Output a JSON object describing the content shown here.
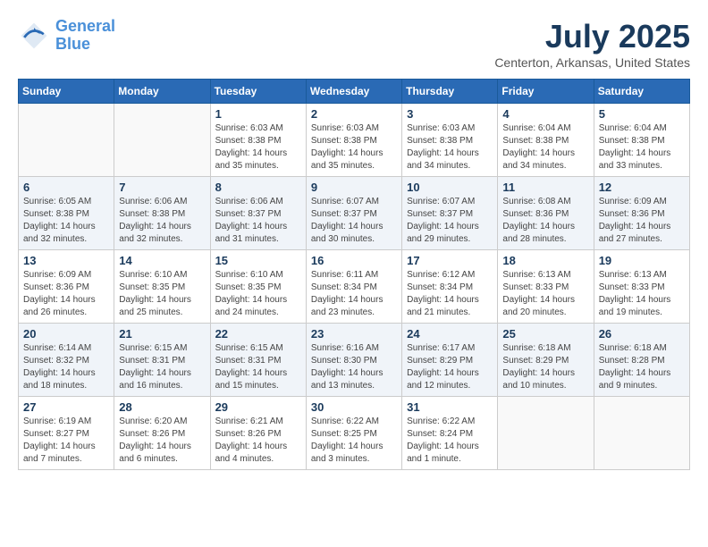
{
  "logo": {
    "line1": "General",
    "line2": "Blue"
  },
  "title": "July 2025",
  "location": "Centerton, Arkansas, United States",
  "weekdays": [
    "Sunday",
    "Monday",
    "Tuesday",
    "Wednesday",
    "Thursday",
    "Friday",
    "Saturday"
  ],
  "weeks": [
    [
      {
        "day": "",
        "sunrise": "",
        "sunset": "",
        "daylight": ""
      },
      {
        "day": "",
        "sunrise": "",
        "sunset": "",
        "daylight": ""
      },
      {
        "day": "1",
        "sunrise": "Sunrise: 6:03 AM",
        "sunset": "Sunset: 8:38 PM",
        "daylight": "Daylight: 14 hours and 35 minutes."
      },
      {
        "day": "2",
        "sunrise": "Sunrise: 6:03 AM",
        "sunset": "Sunset: 8:38 PM",
        "daylight": "Daylight: 14 hours and 35 minutes."
      },
      {
        "day": "3",
        "sunrise": "Sunrise: 6:03 AM",
        "sunset": "Sunset: 8:38 PM",
        "daylight": "Daylight: 14 hours and 34 minutes."
      },
      {
        "day": "4",
        "sunrise": "Sunrise: 6:04 AM",
        "sunset": "Sunset: 8:38 PM",
        "daylight": "Daylight: 14 hours and 34 minutes."
      },
      {
        "day": "5",
        "sunrise": "Sunrise: 6:04 AM",
        "sunset": "Sunset: 8:38 PM",
        "daylight": "Daylight: 14 hours and 33 minutes."
      }
    ],
    [
      {
        "day": "6",
        "sunrise": "Sunrise: 6:05 AM",
        "sunset": "Sunset: 8:38 PM",
        "daylight": "Daylight: 14 hours and 32 minutes."
      },
      {
        "day": "7",
        "sunrise": "Sunrise: 6:06 AM",
        "sunset": "Sunset: 8:38 PM",
        "daylight": "Daylight: 14 hours and 32 minutes."
      },
      {
        "day": "8",
        "sunrise": "Sunrise: 6:06 AM",
        "sunset": "Sunset: 8:37 PM",
        "daylight": "Daylight: 14 hours and 31 minutes."
      },
      {
        "day": "9",
        "sunrise": "Sunrise: 6:07 AM",
        "sunset": "Sunset: 8:37 PM",
        "daylight": "Daylight: 14 hours and 30 minutes."
      },
      {
        "day": "10",
        "sunrise": "Sunrise: 6:07 AM",
        "sunset": "Sunset: 8:37 PM",
        "daylight": "Daylight: 14 hours and 29 minutes."
      },
      {
        "day": "11",
        "sunrise": "Sunrise: 6:08 AM",
        "sunset": "Sunset: 8:36 PM",
        "daylight": "Daylight: 14 hours and 28 minutes."
      },
      {
        "day": "12",
        "sunrise": "Sunrise: 6:09 AM",
        "sunset": "Sunset: 8:36 PM",
        "daylight": "Daylight: 14 hours and 27 minutes."
      }
    ],
    [
      {
        "day": "13",
        "sunrise": "Sunrise: 6:09 AM",
        "sunset": "Sunset: 8:36 PM",
        "daylight": "Daylight: 14 hours and 26 minutes."
      },
      {
        "day": "14",
        "sunrise": "Sunrise: 6:10 AM",
        "sunset": "Sunset: 8:35 PM",
        "daylight": "Daylight: 14 hours and 25 minutes."
      },
      {
        "day": "15",
        "sunrise": "Sunrise: 6:10 AM",
        "sunset": "Sunset: 8:35 PM",
        "daylight": "Daylight: 14 hours and 24 minutes."
      },
      {
        "day": "16",
        "sunrise": "Sunrise: 6:11 AM",
        "sunset": "Sunset: 8:34 PM",
        "daylight": "Daylight: 14 hours and 23 minutes."
      },
      {
        "day": "17",
        "sunrise": "Sunrise: 6:12 AM",
        "sunset": "Sunset: 8:34 PM",
        "daylight": "Daylight: 14 hours and 21 minutes."
      },
      {
        "day": "18",
        "sunrise": "Sunrise: 6:13 AM",
        "sunset": "Sunset: 8:33 PM",
        "daylight": "Daylight: 14 hours and 20 minutes."
      },
      {
        "day": "19",
        "sunrise": "Sunrise: 6:13 AM",
        "sunset": "Sunset: 8:33 PM",
        "daylight": "Daylight: 14 hours and 19 minutes."
      }
    ],
    [
      {
        "day": "20",
        "sunrise": "Sunrise: 6:14 AM",
        "sunset": "Sunset: 8:32 PM",
        "daylight": "Daylight: 14 hours and 18 minutes."
      },
      {
        "day": "21",
        "sunrise": "Sunrise: 6:15 AM",
        "sunset": "Sunset: 8:31 PM",
        "daylight": "Daylight: 14 hours and 16 minutes."
      },
      {
        "day": "22",
        "sunrise": "Sunrise: 6:15 AM",
        "sunset": "Sunset: 8:31 PM",
        "daylight": "Daylight: 14 hours and 15 minutes."
      },
      {
        "day": "23",
        "sunrise": "Sunrise: 6:16 AM",
        "sunset": "Sunset: 8:30 PM",
        "daylight": "Daylight: 14 hours and 13 minutes."
      },
      {
        "day": "24",
        "sunrise": "Sunrise: 6:17 AM",
        "sunset": "Sunset: 8:29 PM",
        "daylight": "Daylight: 14 hours and 12 minutes."
      },
      {
        "day": "25",
        "sunrise": "Sunrise: 6:18 AM",
        "sunset": "Sunset: 8:29 PM",
        "daylight": "Daylight: 14 hours and 10 minutes."
      },
      {
        "day": "26",
        "sunrise": "Sunrise: 6:18 AM",
        "sunset": "Sunset: 8:28 PM",
        "daylight": "Daylight: 14 hours and 9 minutes."
      }
    ],
    [
      {
        "day": "27",
        "sunrise": "Sunrise: 6:19 AM",
        "sunset": "Sunset: 8:27 PM",
        "daylight": "Daylight: 14 hours and 7 minutes."
      },
      {
        "day": "28",
        "sunrise": "Sunrise: 6:20 AM",
        "sunset": "Sunset: 8:26 PM",
        "daylight": "Daylight: 14 hours and 6 minutes."
      },
      {
        "day": "29",
        "sunrise": "Sunrise: 6:21 AM",
        "sunset": "Sunset: 8:26 PM",
        "daylight": "Daylight: 14 hours and 4 minutes."
      },
      {
        "day": "30",
        "sunrise": "Sunrise: 6:22 AM",
        "sunset": "Sunset: 8:25 PM",
        "daylight": "Daylight: 14 hours and 3 minutes."
      },
      {
        "day": "31",
        "sunrise": "Sunrise: 6:22 AM",
        "sunset": "Sunset: 8:24 PM",
        "daylight": "Daylight: 14 hours and 1 minute."
      },
      {
        "day": "",
        "sunrise": "",
        "sunset": "",
        "daylight": ""
      },
      {
        "day": "",
        "sunrise": "",
        "sunset": "",
        "daylight": ""
      }
    ]
  ]
}
